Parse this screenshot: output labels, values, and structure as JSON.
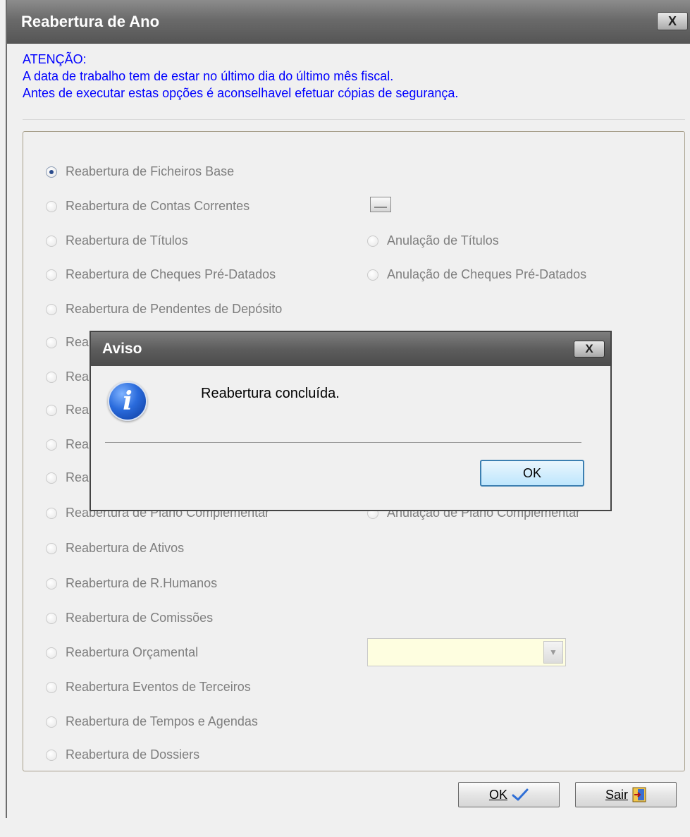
{
  "window": {
    "title": "Reabertura de Ano",
    "close_glyph": "X"
  },
  "warning": {
    "heading": "ATENÇÃO:",
    "line1": "A data de trabalho tem de estar no último dia do último mês fiscal.",
    "line2": "Antes de executar estas opções é aconselhavel efetuar cópias de segurança."
  },
  "options": {
    "ficheiros_base": "Reabertura de Ficheiros Base",
    "contas_correntes": "Reabertura de Contas Correntes",
    "titulos": "Reabertura de Títulos",
    "anulacao_titulos": "Anulação de Títulos",
    "cheques": "Reabertura de Cheques Pré-Datados",
    "anulacao_cheques": "Anulação de Cheques Pré-Datados",
    "pendentes": "Reabertura de Pendentes de Depósito",
    "hidden_prefix": "Rea",
    "plano_complementar": "Reabertura de Plano Complementar",
    "anulacao_plano": "Anulação de Plano Complementar",
    "ativos": "Reabertura de Ativos",
    "rhumanos": "Reabertura de R.Humanos",
    "comissoes": "Reabertura de Comissões",
    "orcamental": "Reabertura Orçamental",
    "eventos": "Reabertura Eventos de Terceiros",
    "tempos": "Reabertura de Tempos e Agendas",
    "dossiers": "Reabertura de Dossiers",
    "selected": "Reabertura de Ficheiros Base"
  },
  "combo": {
    "value": ""
  },
  "buttons": {
    "ok": "OK",
    "sair": "Sair"
  },
  "dialog": {
    "title": "Aviso",
    "close_glyph": "X",
    "message": "Reabertura concluída.",
    "ok": "OK",
    "icon": "info-icon"
  },
  "colors": {
    "warning_text": "#0000ff",
    "disabled_text": "#7e7e7e",
    "combo_bg": "#fefee0",
    "titlebar": "#666666"
  }
}
